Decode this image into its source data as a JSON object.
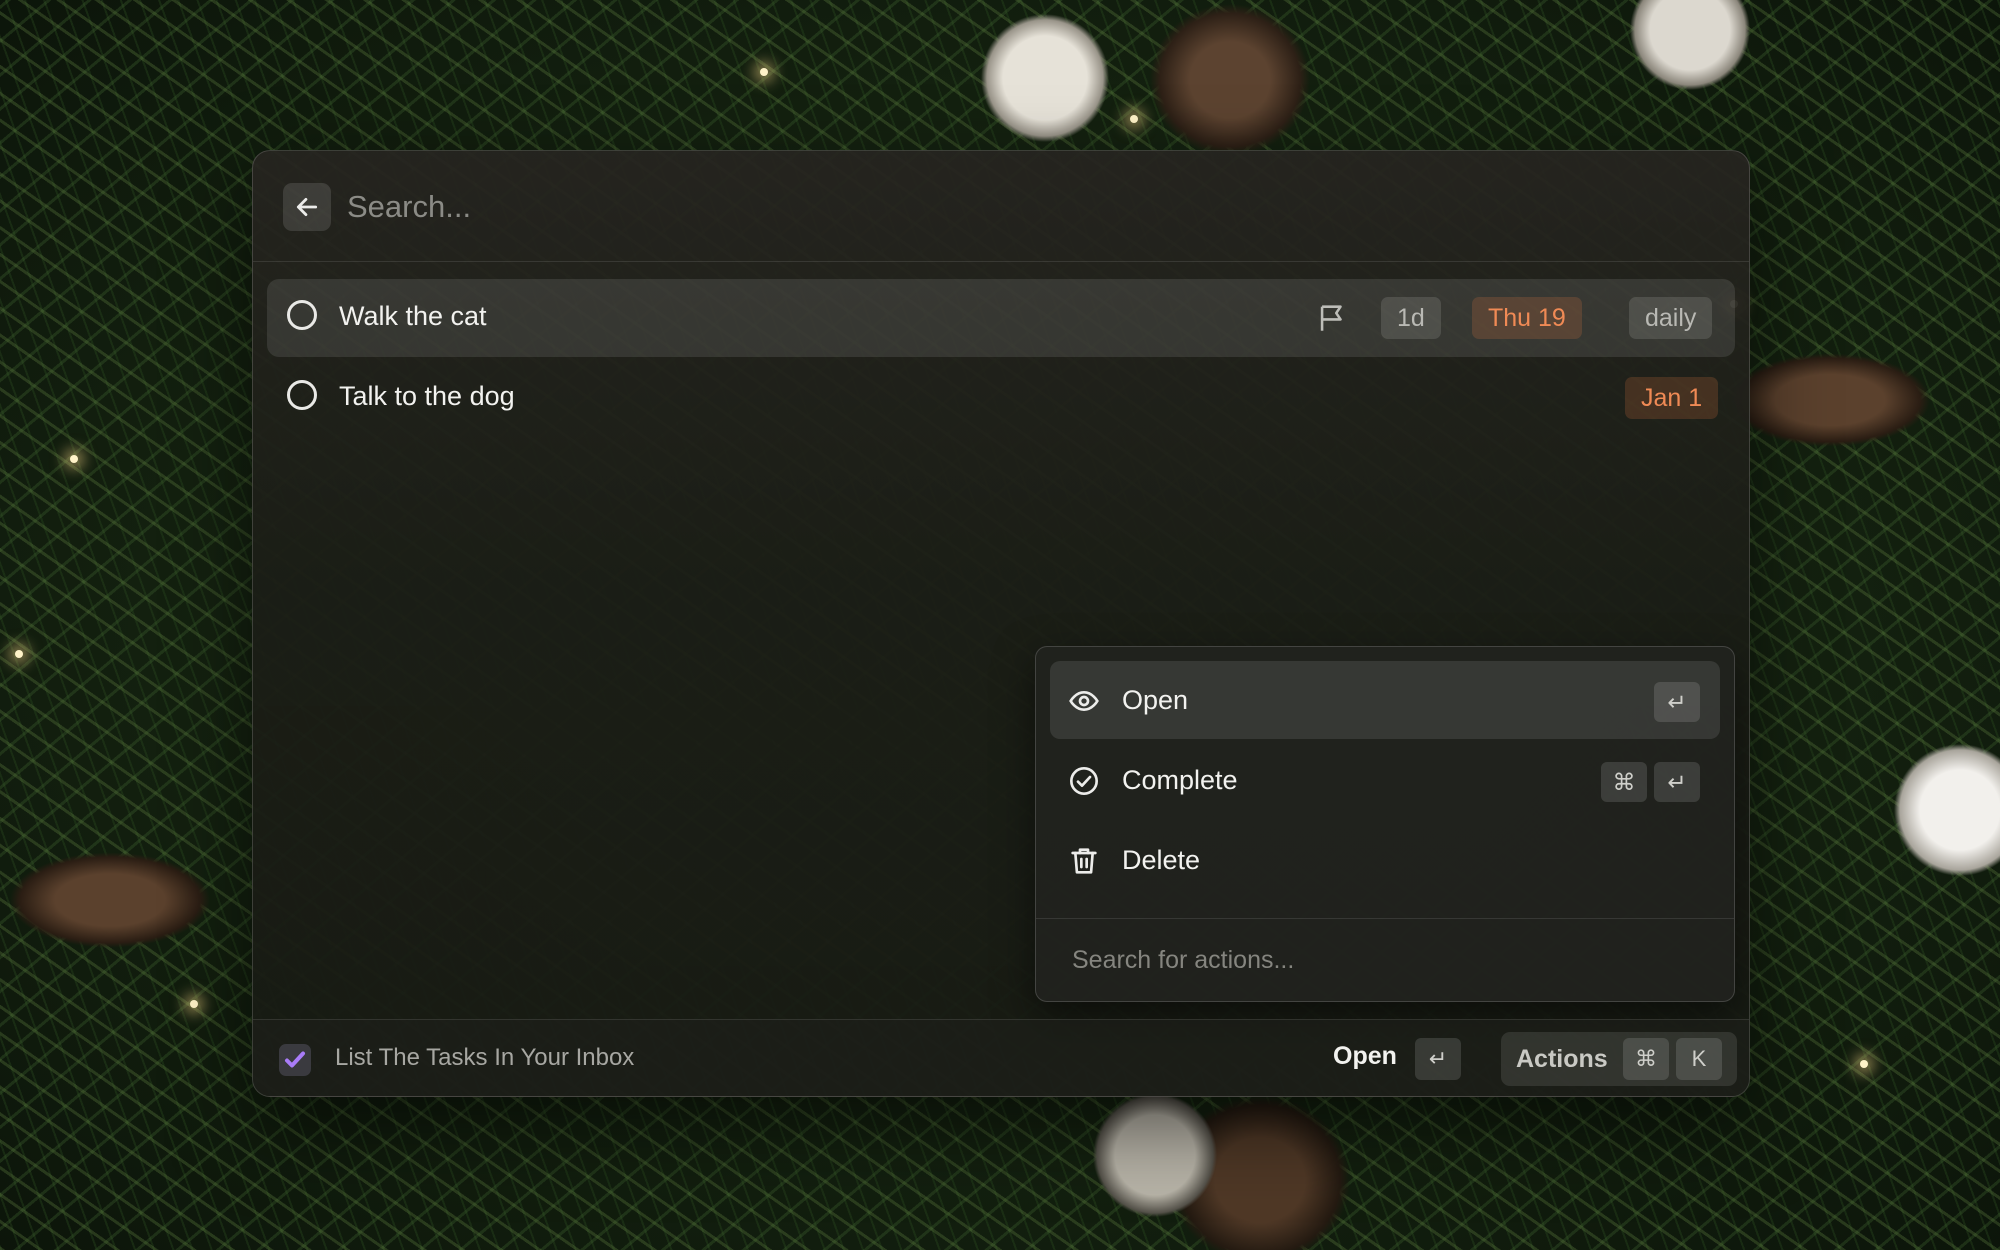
{
  "search": {
    "placeholder": "Search..."
  },
  "tasks": [
    {
      "title": "Walk the cat",
      "estimate": "1d",
      "due": "Thu 19",
      "recurrence": "daily",
      "flagged": true
    },
    {
      "title": "Talk to the dog",
      "due": "Jan 1"
    }
  ],
  "actions_menu": {
    "items": [
      {
        "label": "Open",
        "icon": "eye-icon",
        "shortcut": [
          "↵"
        ]
      },
      {
        "label": "Complete",
        "icon": "check-circle-icon",
        "shortcut": [
          "⌘",
          "↵"
        ]
      },
      {
        "label": "Delete",
        "icon": "trash-icon",
        "shortcut": []
      }
    ],
    "search_placeholder": "Search for actions..."
  },
  "footer": {
    "command_title": "List The Tasks In Your Inbox",
    "primary_action": "Open",
    "primary_key": "↵",
    "actions_label": "Actions",
    "actions_keys": [
      "⌘",
      "K"
    ]
  },
  "colors": {
    "accent_date": "#f08a55",
    "app_icon_check": "#a97cf8"
  }
}
